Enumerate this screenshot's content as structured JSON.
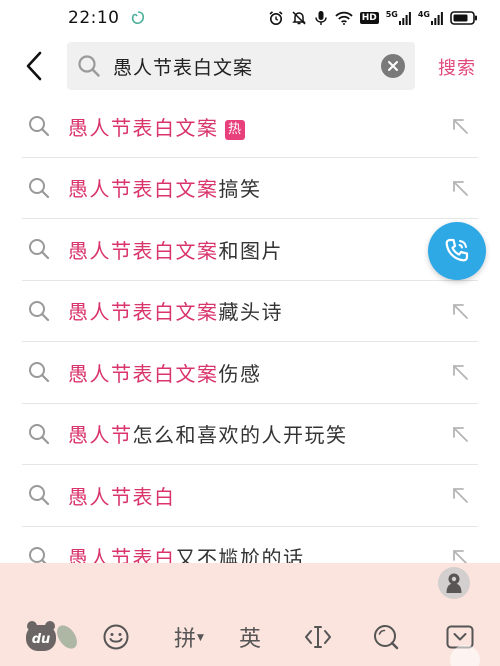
{
  "status_bar": {
    "time": "22:10",
    "signal_1_label": "5G",
    "signal_2_label": "4G",
    "hd_label": "HD"
  },
  "search": {
    "query": "愚人节表白文案",
    "submit_label": "搜索"
  },
  "suggestions": [
    {
      "highlight": "愚人节表白文案",
      "rest": "",
      "badge": "热"
    },
    {
      "highlight": "愚人节表白文案",
      "rest": "搞笑"
    },
    {
      "highlight": "愚人节表白文案",
      "rest": "和图片"
    },
    {
      "highlight": "愚人节表白文案",
      "rest": "藏头诗"
    },
    {
      "highlight": "愚人节表白文案",
      "rest": "伤感"
    },
    {
      "highlight": "愚人节",
      "rest": "怎么和喜欢的人开玩笑"
    },
    {
      "highlight": "愚人节表白",
      "rest": ""
    },
    {
      "highlight": "愚人节表白",
      "rest": "又不尴尬的话"
    }
  ],
  "keyboard": {
    "logo_label": "du",
    "pinyin_label": "拼",
    "english_label": "英",
    "cursor_label": "‹I›"
  },
  "colors": {
    "accent": "#e0487d",
    "highlight": "#d9356b",
    "call_button": "#2fa9e6",
    "keyboard_bg": "#fbe4de"
  },
  "icons": {
    "back": "chevron-left-icon",
    "search": "search-icon",
    "clear": "clear-icon",
    "fill": "arrow-up-left-icon",
    "call": "phone-icon",
    "emoji": "smiley-icon",
    "keyboard_search": "search-icon",
    "hide_keyboard": "keyboard-hide-icon"
  }
}
